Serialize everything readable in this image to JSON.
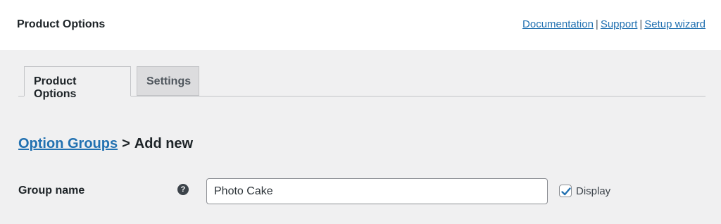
{
  "header": {
    "title": "Product Options",
    "links": [
      "Documentation",
      "Support",
      "Setup wizard"
    ],
    "separator": "|"
  },
  "tabs": [
    {
      "label": "Product Options",
      "active": true
    },
    {
      "label": "Settings",
      "active": false
    }
  ],
  "breadcrumb": {
    "link": "Option Groups",
    "separator": ">",
    "current": "Add new"
  },
  "form": {
    "group_name_label": "Group name",
    "help_icon_glyph": "?",
    "group_name_value": "Photo Cake",
    "display_checked": true,
    "display_label": "Display"
  },
  "colors": {
    "link": "#2271b1",
    "background": "#f0f0f1",
    "header_bg": "#ffffff"
  }
}
